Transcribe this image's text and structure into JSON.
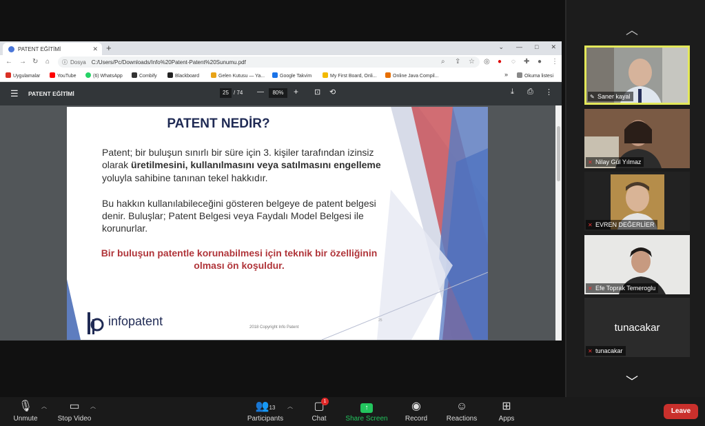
{
  "browser": {
    "tab_title": "PATENT EĞİTİMİ",
    "new_tab": "+",
    "window_controls": [
      "⌄",
      "—",
      "□",
      "✕"
    ],
    "address_prefix": "Dosya",
    "address": "C:/Users/Pc/Downloads/Info%20Patent-Patent%20Sunumu.pdf",
    "bookmarks": [
      {
        "label": "Uygulamalar",
        "color": "#d93025"
      },
      {
        "label": "YouTube",
        "color": "#ff0000"
      },
      {
        "label": "(6) WhatsApp",
        "color": "#25d366"
      },
      {
        "label": "Combify",
        "color": "#333333"
      },
      {
        "label": "Blackboard",
        "color": "#222222"
      },
      {
        "label": "Gelen Kutusu — Ya...",
        "color": "#e8a317"
      },
      {
        "label": "Google Takvim",
        "color": "#1a73e8"
      },
      {
        "label": "My First Board, Onli...",
        "color": "#f2b900"
      },
      {
        "label": "Online Java Compil...",
        "color": "#e76f00"
      },
      {
        "label": "»",
        "color": ""
      },
      {
        "label": "Okuma listesi",
        "color": "#888888"
      }
    ]
  },
  "pdf": {
    "title": "PATENT EĞİTİMİ",
    "page_current": "25",
    "page_total": "/ 74",
    "zoom": "80%",
    "zoom_minus": "—",
    "zoom_plus": "+"
  },
  "slide": {
    "title": "PATENT NEDİR?",
    "p1_line1": "Patent; bir buluşun sınırlı bir süre için 3. kişiler tarafından izinsiz",
    "p1_line2_normal": "olarak ",
    "p1_line2_bold": "üretilmesini, kullanılmasını veya satılmasını engelleme",
    "p1_line3": "yoluyla sahibine tanınan tekel hakkıdır.",
    "p2_line1": "Bu hakkın kullanılabileceğini gösteren belgeye de patent belgesi",
    "p2_line2": "denir. Buluşlar; Patent Belgesi veya Faydalı Model Belgesi ile",
    "p2_line3": "korunurlar.",
    "highlight_line1": "Bir buluşun patentle korunabilmesi için teknik bir özelliğinin",
    "highlight_line2": "olması ön koşuldur.",
    "logo_text": "infopatent",
    "copyright": "2018 Copyright Info Patent",
    "page_mark": "25"
  },
  "participants_gallery": [
    {
      "name": "Saner kayal",
      "muted": false,
      "active_speaker": true
    },
    {
      "name": "Nilay Gül Yılmaz",
      "muted": true
    },
    {
      "name": "EVREN DEĞERLİER",
      "muted": true
    },
    {
      "name": "Efe Toprak Temeroglu",
      "muted": true
    },
    {
      "name": "tunacakar",
      "muted": true,
      "video_off_label": "tunacakar"
    }
  ],
  "toolbar": {
    "unmute": "Unmute",
    "stop_video": "Stop Video",
    "participants": "Participants",
    "participants_count": "13",
    "chat": "Chat",
    "chat_badge": "1",
    "share_screen": "Share Screen",
    "record": "Record",
    "reactions": "Reactions",
    "apps": "Apps",
    "leave": "Leave"
  },
  "colors": {
    "leave_red": "#c9302c",
    "share_green": "#23c55e",
    "active_speaker_border": "#e3e85a",
    "slide_title": "#1f2a54",
    "slide_highlight": "#b0353a"
  }
}
